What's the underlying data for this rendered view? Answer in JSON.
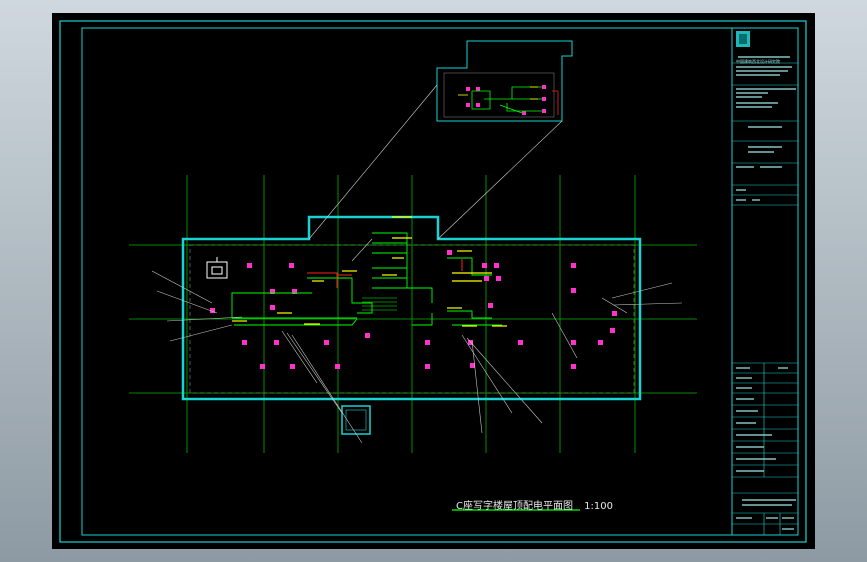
{
  "drawing": {
    "caption": "C座写字楼屋顶配电平面图",
    "scale": "1:100",
    "colors": {
      "background": "#000000",
      "frame": "#19d2d2",
      "grid": "#00c800",
      "wiring": "#00ff00",
      "equipment": "#ff33cc",
      "feeder": "#ff2222",
      "yellow": "#ffff00",
      "leader": "#c8c8c8"
    }
  },
  "title_block": {
    "institute_line": "中国建筑西北设计研究院"
  }
}
